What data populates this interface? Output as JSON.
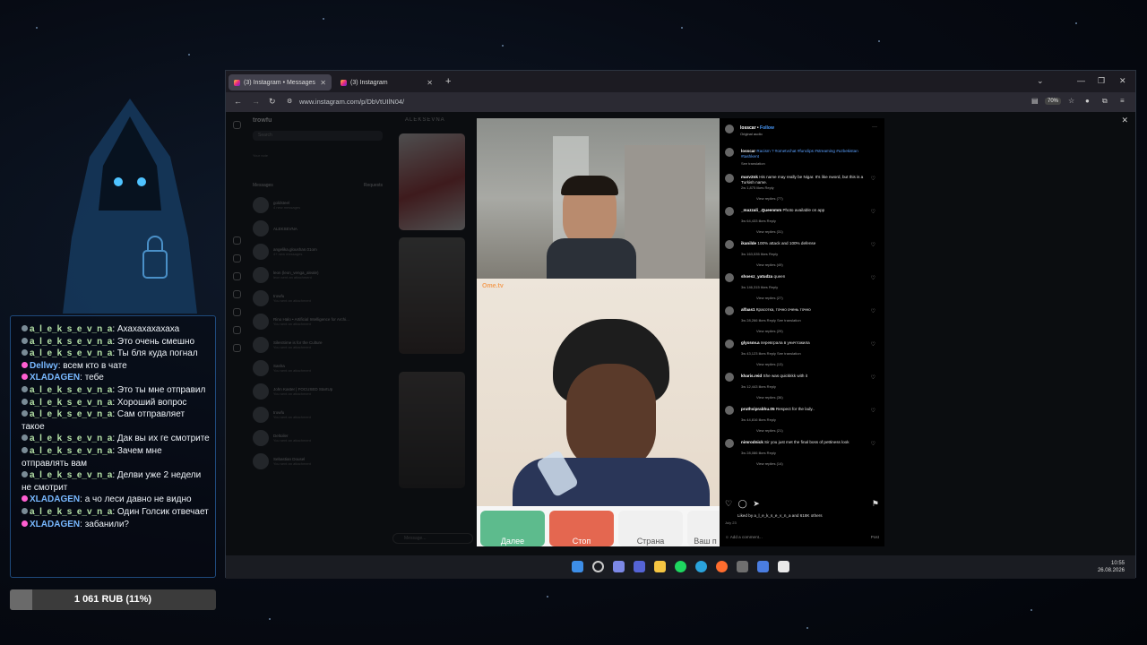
{
  "chat": {
    "messages": [
      {
        "user": "a_l_e_k_s_e_v_n_a",
        "text": "Ахахахахахаха",
        "color": "green"
      },
      {
        "user": "a_l_e_k_s_e_v_n_a",
        "text": "Это очень смешно",
        "color": "green"
      },
      {
        "user": "a_l_e_k_s_e_v_n_a",
        "text": "Ты бля куда погнал",
        "color": "green"
      },
      {
        "user": "Dellwy",
        "text": "всем кто в чате",
        "color": "blue"
      },
      {
        "user": "XLADAGEN",
        "text": "тебе",
        "color": "blue"
      },
      {
        "user": "a_l_e_k_s_e_v_n_a",
        "text": "Это ты мне отправил",
        "color": "green"
      },
      {
        "user": "a_l_e_k_s_e_v_n_a",
        "text": "Хороший вопрос",
        "color": "green"
      },
      {
        "user": "a_l_e_k_s_e_v_n_a",
        "text": "Сам отправляет такое",
        "color": "green"
      },
      {
        "user": "a_l_e_k_s_e_v_n_a",
        "text": "Дак вы их ге смотрите",
        "color": "green"
      },
      {
        "user": "a_l_e_k_s_e_v_n_a",
        "text": "Зачем мне отправлять вам",
        "color": "green"
      },
      {
        "user": "a_l_e_k_s_e_v_n_a",
        "text": "Делви уже 2 недели не смотрит",
        "color": "green"
      },
      {
        "user": "XLADAGEN",
        "text": "а чо леси давно не видно",
        "color": "blue"
      },
      {
        "user": "a_l_e_k_s_e_v_n_a",
        "text": "Один Голсик отвечает",
        "color": "green"
      },
      {
        "user": "XLADAGEN",
        "text": "забанили?",
        "color": "blue"
      }
    ]
  },
  "donation": {
    "label": "1 061 RUB (11%)",
    "progress": 0.11
  },
  "browser": {
    "tabs": [
      {
        "label": "(3) Instagram • Messages"
      },
      {
        "label": "(3) Instagram"
      }
    ],
    "url": "www.instagram.com/p/DbVtUIlN04/",
    "zoom": "70%"
  },
  "instagram": {
    "user": "trowfu",
    "search": "Search",
    "your_note": "Your note",
    "messages_label": "Messages",
    "requests_label": "Requests",
    "conversation_title": "ALEKSEVNA",
    "message_placeholder": "Message...",
    "dms": [
      {
        "name": "goldsteel",
        "preview": "4 new messages"
      },
      {
        "name": "ALEKSEVNA",
        "preview": ""
      },
      {
        "name": "angelika.gloushan.01om",
        "preview": "4+ new messages"
      },
      {
        "name": "leon (leon_venga_aleale)",
        "preview": "leon sent an attachment"
      },
      {
        "name": "trowfu",
        "preview": "You sent an attachment"
      },
      {
        "name": "Rino Halo • Artificial Intelligence for Archi...",
        "preview": "You sent an attachment"
      },
      {
        "name": "SilenSime is for the Culture",
        "preview": "You sent an attachment"
      },
      {
        "name": "Sasha",
        "preview": "You sent an attachment"
      },
      {
        "name": "John Kaster | FOCUSED StartUp",
        "preview": "You sent an attachment"
      },
      {
        "name": "trowfu",
        "preview": "You sent an attachment"
      },
      {
        "name": "Deltoiler",
        "preview": "You sent an attachment"
      },
      {
        "name": "Sebastian Dousel",
        "preview": "You sent an attachment"
      }
    ]
  },
  "ometv": {
    "brand": "Ome.tv",
    "buttons": [
      {
        "label": "Далее",
        "color": "#5dbb8d"
      },
      {
        "label": "Стоп",
        "color": "#e46750"
      },
      {
        "label": "Страна",
        "color": "#f0f0f0"
      },
      {
        "label": "Ваш п",
        "color": "#f0f0f0"
      }
    ]
  },
  "post": {
    "author": "losscar",
    "follow": "Follow",
    "audio": "Original audio",
    "caption_author": "losscar",
    "caption": "Racism ? #ometvchat #funclips #streaming #uzbekistan #tashkent",
    "caption_meta": "See translation",
    "comments": [
      {
        "user": "marv2nk",
        "text": "His name may really be Nigar. It's like nword, but this is a Turkish name.",
        "meta": "2w  1,875 likes  Reply",
        "replies": "View replies (77)"
      },
      {
        "user": "_mazzali_.Queenmm",
        "text": "Photo available on app",
        "meta": "3w  64,433 likes  Reply",
        "replies": "View replies (31)"
      },
      {
        "user": "ikanilde",
        "text": "100% attack and 100% defense",
        "meta": "3w  163,535 likes  Reply",
        "replies": "View replies (49)"
      },
      {
        "user": "shoesz_yatudza",
        "text": "queen",
        "meta": "3w  146,315 likes  Reply",
        "replies": "View replies (27)"
      },
      {
        "user": "alfaas1",
        "text": "Красотка, точно очень точно",
        "meta": "3w  28,266 likes  Reply  See translation",
        "replies": "View replies (29)"
      },
      {
        "user": "glyxsov.a",
        "text": "перевграла в уничтожила",
        "meta": "3w  43,123 likes  Reply  See translation",
        "replies": "View replies (13)"
      },
      {
        "user": "kharis.reid",
        "text": "She was quickkkk with it",
        "meta": "3w  12,443 likes  Reply",
        "replies": "View replies (36)"
      },
      {
        "user": "pruthviprabhu.05",
        "text": "Respect for the lady..",
        "meta": "3w  44,816 likes  Reply",
        "replies": "View replies (21)"
      },
      {
        "user": "nimrodnick",
        "text": "Sir you just met the final boss of pettiness look",
        "meta": "3w  28,086 likes  Reply",
        "replies": "View replies (14)"
      }
    ],
    "likes": "Liked by a_l_e_k_s_e_v_n_a and 618K others",
    "date": "July 23",
    "add_comment": "Add a comment...",
    "post_label": "Post"
  },
  "clock": {
    "time": "10:55",
    "date": "26.08.2026"
  }
}
